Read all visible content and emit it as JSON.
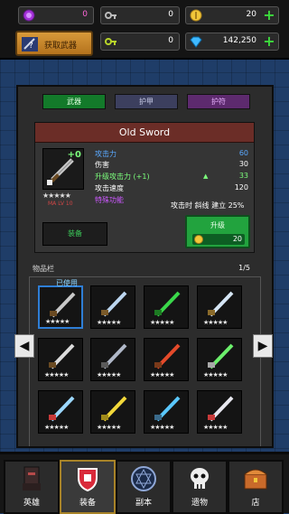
{
  "topbar": {
    "gems_purple": "0",
    "key_silver": "0",
    "gold": "20",
    "key_gold": "0",
    "diamonds": "142,250",
    "fetch_weapon_label": "获取武器"
  },
  "tabs": [
    {
      "label": "武器"
    },
    {
      "label": "护甲"
    },
    {
      "label": "护符"
    }
  ],
  "item": {
    "name": "Old Sword",
    "plus": "+0",
    "stars": "★★★★★",
    "ma_lv": "MA LV 10",
    "equip_label": "装备",
    "stats": [
      {
        "label": "攻击力",
        "value": "60",
        "color": "#5aa9ff"
      },
      {
        "label": "伤害",
        "value": "30",
        "color": "#ffffff"
      },
      {
        "label": "升级攻击力 (+1)",
        "value": "33",
        "color": "#7cff7c"
      },
      {
        "label": "攻击速度",
        "value": "120",
        "color": "#ffffff"
      },
      {
        "label": "特殊功能",
        "value": "",
        "color": "#cc58ff"
      }
    ],
    "special_text": "攻击时 斜线 建立 25%",
    "upgrade_label": "升级",
    "upgrade_cost": "20"
  },
  "inventory": {
    "label": "物品栏",
    "page": "1/5",
    "used_label": "已使用",
    "items": [
      {
        "icon": "old-sword",
        "stars": "★★★★★"
      },
      {
        "icon": "serrated-blade",
        "stars": "★★★★★"
      },
      {
        "icon": "green-trident",
        "stars": "★★★★★"
      },
      {
        "icon": "serrated-blade-2",
        "stars": "★★★★★"
      },
      {
        "icon": "battle-axe",
        "stars": "★★★★★"
      },
      {
        "icon": "hammer-axe",
        "stars": "★★★★★"
      },
      {
        "icon": "fire-staff",
        "stars": "★★★★★"
      },
      {
        "icon": "green-spear",
        "stars": "★★★★★"
      },
      {
        "icon": "ice-sword",
        "stars": "★★★★★"
      },
      {
        "icon": "gold-scepter",
        "stars": "★★★★★"
      },
      {
        "icon": "hook-staff",
        "stars": "★★★★★"
      },
      {
        "icon": "drill-lance",
        "stars": "★★★★★"
      }
    ]
  },
  "bottom_nav": [
    {
      "label": "英雄",
      "icon": "hero-icon"
    },
    {
      "label": "装备",
      "icon": "equipment-icon"
    },
    {
      "label": "副本",
      "icon": "dungeon-icon"
    },
    {
      "label": "遗物",
      "icon": "relic-icon"
    },
    {
      "label": "店",
      "icon": "shop-icon"
    }
  ]
}
